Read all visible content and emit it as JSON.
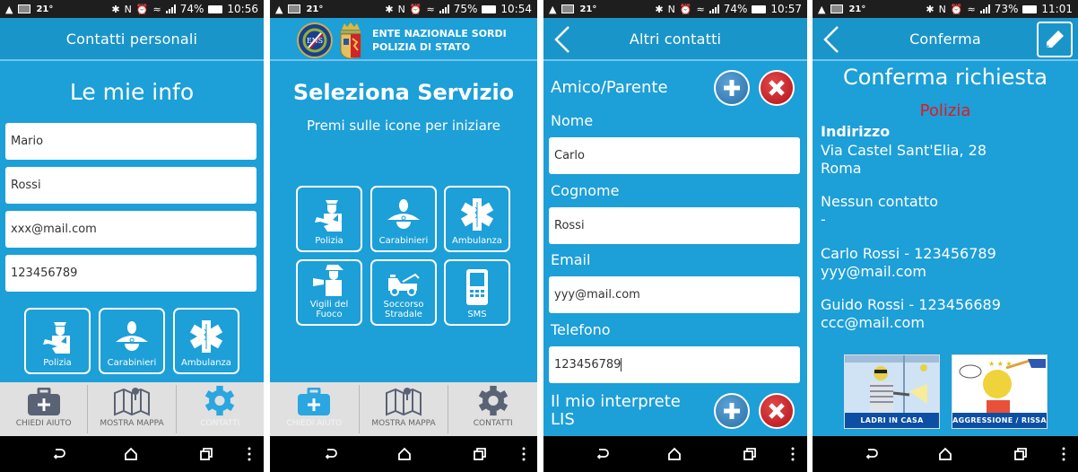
{
  "screens": [
    {
      "status": {
        "temp": "21°",
        "battery": "74%",
        "time": "10:56"
      },
      "header_title": "Contatti personali",
      "page_title": "Le mie info",
      "fields": [
        {
          "value": "Mario"
        },
        {
          "value": "Rossi"
        },
        {
          "value": "xxx@mail.com"
        },
        {
          "value": "123456789"
        }
      ],
      "services": [
        {
          "label": "Polizia",
          "icon": "police-officer-icon"
        },
        {
          "label": "Carabinieri",
          "icon": "carabiniere-icon"
        },
        {
          "label": "Ambulanza",
          "icon": "star-of-life-icon"
        }
      ],
      "bottom_nav": [
        {
          "label": "CHIEDI AIUTO",
          "icon": "first-aid-kit-icon",
          "active": false
        },
        {
          "label": "MOSTRA MAPPA",
          "icon": "map-pin-icon",
          "active": false
        },
        {
          "label": "CONTATTI",
          "icon": "gear-icon",
          "active": true
        }
      ]
    },
    {
      "status": {
        "temp": "21°",
        "battery": "75%",
        "time": "10:54"
      },
      "header_line1": "ENTE NAZIONALE SORDI",
      "header_line2": "POLIZIA DI STATO",
      "page_title": "Seleziona Servizio",
      "subtitle": "Premi sulle icone per iniziare",
      "services": [
        {
          "label": "Polizia",
          "icon": "police-officer-icon"
        },
        {
          "label": "Carabinieri",
          "icon": "carabiniere-icon"
        },
        {
          "label": "Ambulanza",
          "icon": "star-of-life-icon"
        },
        {
          "label": "Vigili del Fuoco",
          "icon": "firefighter-icon"
        },
        {
          "label": "Soccorso Stradale",
          "icon": "tow-truck-icon"
        },
        {
          "label": "SMS",
          "icon": "mobile-phone-icon"
        }
      ],
      "bottom_nav": [
        {
          "label": "CHIEDI AIUTO",
          "icon": "first-aid-kit-icon",
          "active": true
        },
        {
          "label": "MOSTRA MAPPA",
          "icon": "map-pin-icon",
          "active": false
        },
        {
          "label": "CONTATTI",
          "icon": "gear-icon",
          "active": false
        }
      ]
    },
    {
      "status": {
        "temp": "21°",
        "battery": "74%",
        "time": "10:57"
      },
      "header_title": "Altri contatti",
      "section1_title": "Amico/Parente",
      "labels": {
        "nome": "Nome",
        "cognome": "Cognome",
        "email": "Email",
        "telefono": "Telefono"
      },
      "fields": {
        "nome": "Carlo",
        "cognome": "Rossi",
        "email": "yyy@mail.com",
        "telefono": "123456789"
      },
      "section2_line1": "Il mio interprete",
      "section2_line2": "LIS"
    },
    {
      "status": {
        "temp": "21°",
        "battery": "73%",
        "time": "11:01"
      },
      "header_title": "Conferma",
      "page_title": "Conferma richiesta",
      "service": "Polizia",
      "service_color": "#e8161d",
      "address_label": "Indirizzo",
      "address_line1": "Via Castel Sant'Elia, 28",
      "address_line2": "Roma",
      "interpreter_line1": "Nessun contatto",
      "interpreter_line2": "-",
      "contact1_line1": "Carlo Rossi - 123456789",
      "contact1_line2": "yyy@mail.com",
      "contact2_line1": "Guido Rossi - 123456689",
      "contact2_line2": "ccc@mail.com",
      "situations": [
        {
          "caption": "LADRI IN CASA"
        },
        {
          "caption": "AGGRESSIONE / RISSA"
        }
      ]
    }
  ],
  "colors": {
    "primary": "#1d9fd8",
    "header": "#1a95c9",
    "nav_bg": "#e0e0e0",
    "nav_icon": "#5a6275",
    "nav_active": "#2aa6e0"
  }
}
